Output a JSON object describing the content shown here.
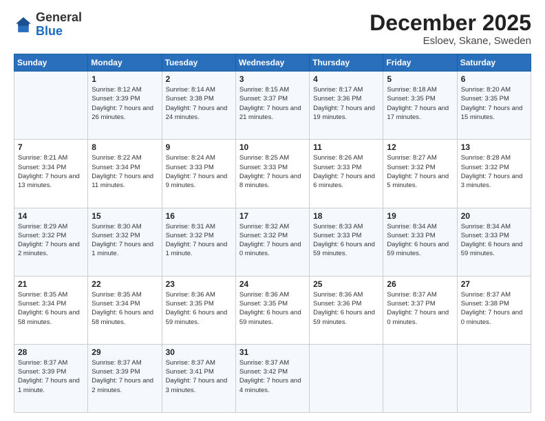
{
  "logo": {
    "general": "General",
    "blue": "Blue"
  },
  "header": {
    "month": "December 2025",
    "location": "Esloev, Skane, Sweden"
  },
  "weekdays": [
    "Sunday",
    "Monday",
    "Tuesday",
    "Wednesday",
    "Thursday",
    "Friday",
    "Saturday"
  ],
  "weeks": [
    [
      {
        "day": "",
        "info": ""
      },
      {
        "day": "1",
        "info": "Sunrise: 8:12 AM\nSunset: 3:39 PM\nDaylight: 7 hours\nand 26 minutes."
      },
      {
        "day": "2",
        "info": "Sunrise: 8:14 AM\nSunset: 3:38 PM\nDaylight: 7 hours\nand 24 minutes."
      },
      {
        "day": "3",
        "info": "Sunrise: 8:15 AM\nSunset: 3:37 PM\nDaylight: 7 hours\nand 21 minutes."
      },
      {
        "day": "4",
        "info": "Sunrise: 8:17 AM\nSunset: 3:36 PM\nDaylight: 7 hours\nand 19 minutes."
      },
      {
        "day": "5",
        "info": "Sunrise: 8:18 AM\nSunset: 3:35 PM\nDaylight: 7 hours\nand 17 minutes."
      },
      {
        "day": "6",
        "info": "Sunrise: 8:20 AM\nSunset: 3:35 PM\nDaylight: 7 hours\nand 15 minutes."
      }
    ],
    [
      {
        "day": "7",
        "info": "Sunrise: 8:21 AM\nSunset: 3:34 PM\nDaylight: 7 hours\nand 13 minutes."
      },
      {
        "day": "8",
        "info": "Sunrise: 8:22 AM\nSunset: 3:34 PM\nDaylight: 7 hours\nand 11 minutes."
      },
      {
        "day": "9",
        "info": "Sunrise: 8:24 AM\nSunset: 3:33 PM\nDaylight: 7 hours\nand 9 minutes."
      },
      {
        "day": "10",
        "info": "Sunrise: 8:25 AM\nSunset: 3:33 PM\nDaylight: 7 hours\nand 8 minutes."
      },
      {
        "day": "11",
        "info": "Sunrise: 8:26 AM\nSunset: 3:33 PM\nDaylight: 7 hours\nand 6 minutes."
      },
      {
        "day": "12",
        "info": "Sunrise: 8:27 AM\nSunset: 3:32 PM\nDaylight: 7 hours\nand 5 minutes."
      },
      {
        "day": "13",
        "info": "Sunrise: 8:28 AM\nSunset: 3:32 PM\nDaylight: 7 hours\nand 3 minutes."
      }
    ],
    [
      {
        "day": "14",
        "info": "Sunrise: 8:29 AM\nSunset: 3:32 PM\nDaylight: 7 hours\nand 2 minutes."
      },
      {
        "day": "15",
        "info": "Sunrise: 8:30 AM\nSunset: 3:32 PM\nDaylight: 7 hours\nand 1 minute."
      },
      {
        "day": "16",
        "info": "Sunrise: 8:31 AM\nSunset: 3:32 PM\nDaylight: 7 hours\nand 1 minute."
      },
      {
        "day": "17",
        "info": "Sunrise: 8:32 AM\nSunset: 3:32 PM\nDaylight: 7 hours\nand 0 minutes."
      },
      {
        "day": "18",
        "info": "Sunrise: 8:33 AM\nSunset: 3:33 PM\nDaylight: 6 hours\nand 59 minutes."
      },
      {
        "day": "19",
        "info": "Sunrise: 8:34 AM\nSunset: 3:33 PM\nDaylight: 6 hours\nand 59 minutes."
      },
      {
        "day": "20",
        "info": "Sunrise: 8:34 AM\nSunset: 3:33 PM\nDaylight: 6 hours\nand 59 minutes."
      }
    ],
    [
      {
        "day": "21",
        "info": "Sunrise: 8:35 AM\nSunset: 3:34 PM\nDaylight: 6 hours\nand 58 minutes."
      },
      {
        "day": "22",
        "info": "Sunrise: 8:35 AM\nSunset: 3:34 PM\nDaylight: 6 hours\nand 58 minutes."
      },
      {
        "day": "23",
        "info": "Sunrise: 8:36 AM\nSunset: 3:35 PM\nDaylight: 6 hours\nand 59 minutes."
      },
      {
        "day": "24",
        "info": "Sunrise: 8:36 AM\nSunset: 3:35 PM\nDaylight: 6 hours\nand 59 minutes."
      },
      {
        "day": "25",
        "info": "Sunrise: 8:36 AM\nSunset: 3:36 PM\nDaylight: 6 hours\nand 59 minutes."
      },
      {
        "day": "26",
        "info": "Sunrise: 8:37 AM\nSunset: 3:37 PM\nDaylight: 7 hours\nand 0 minutes."
      },
      {
        "day": "27",
        "info": "Sunrise: 8:37 AM\nSunset: 3:38 PM\nDaylight: 7 hours\nand 0 minutes."
      }
    ],
    [
      {
        "day": "28",
        "info": "Sunrise: 8:37 AM\nSunset: 3:39 PM\nDaylight: 7 hours\nand 1 minute."
      },
      {
        "day": "29",
        "info": "Sunrise: 8:37 AM\nSunset: 3:39 PM\nDaylight: 7 hours\nand 2 minutes."
      },
      {
        "day": "30",
        "info": "Sunrise: 8:37 AM\nSunset: 3:41 PM\nDaylight: 7 hours\nand 3 minutes."
      },
      {
        "day": "31",
        "info": "Sunrise: 8:37 AM\nSunset: 3:42 PM\nDaylight: 7 hours\nand 4 minutes."
      },
      {
        "day": "",
        "info": ""
      },
      {
        "day": "",
        "info": ""
      },
      {
        "day": "",
        "info": ""
      }
    ]
  ]
}
